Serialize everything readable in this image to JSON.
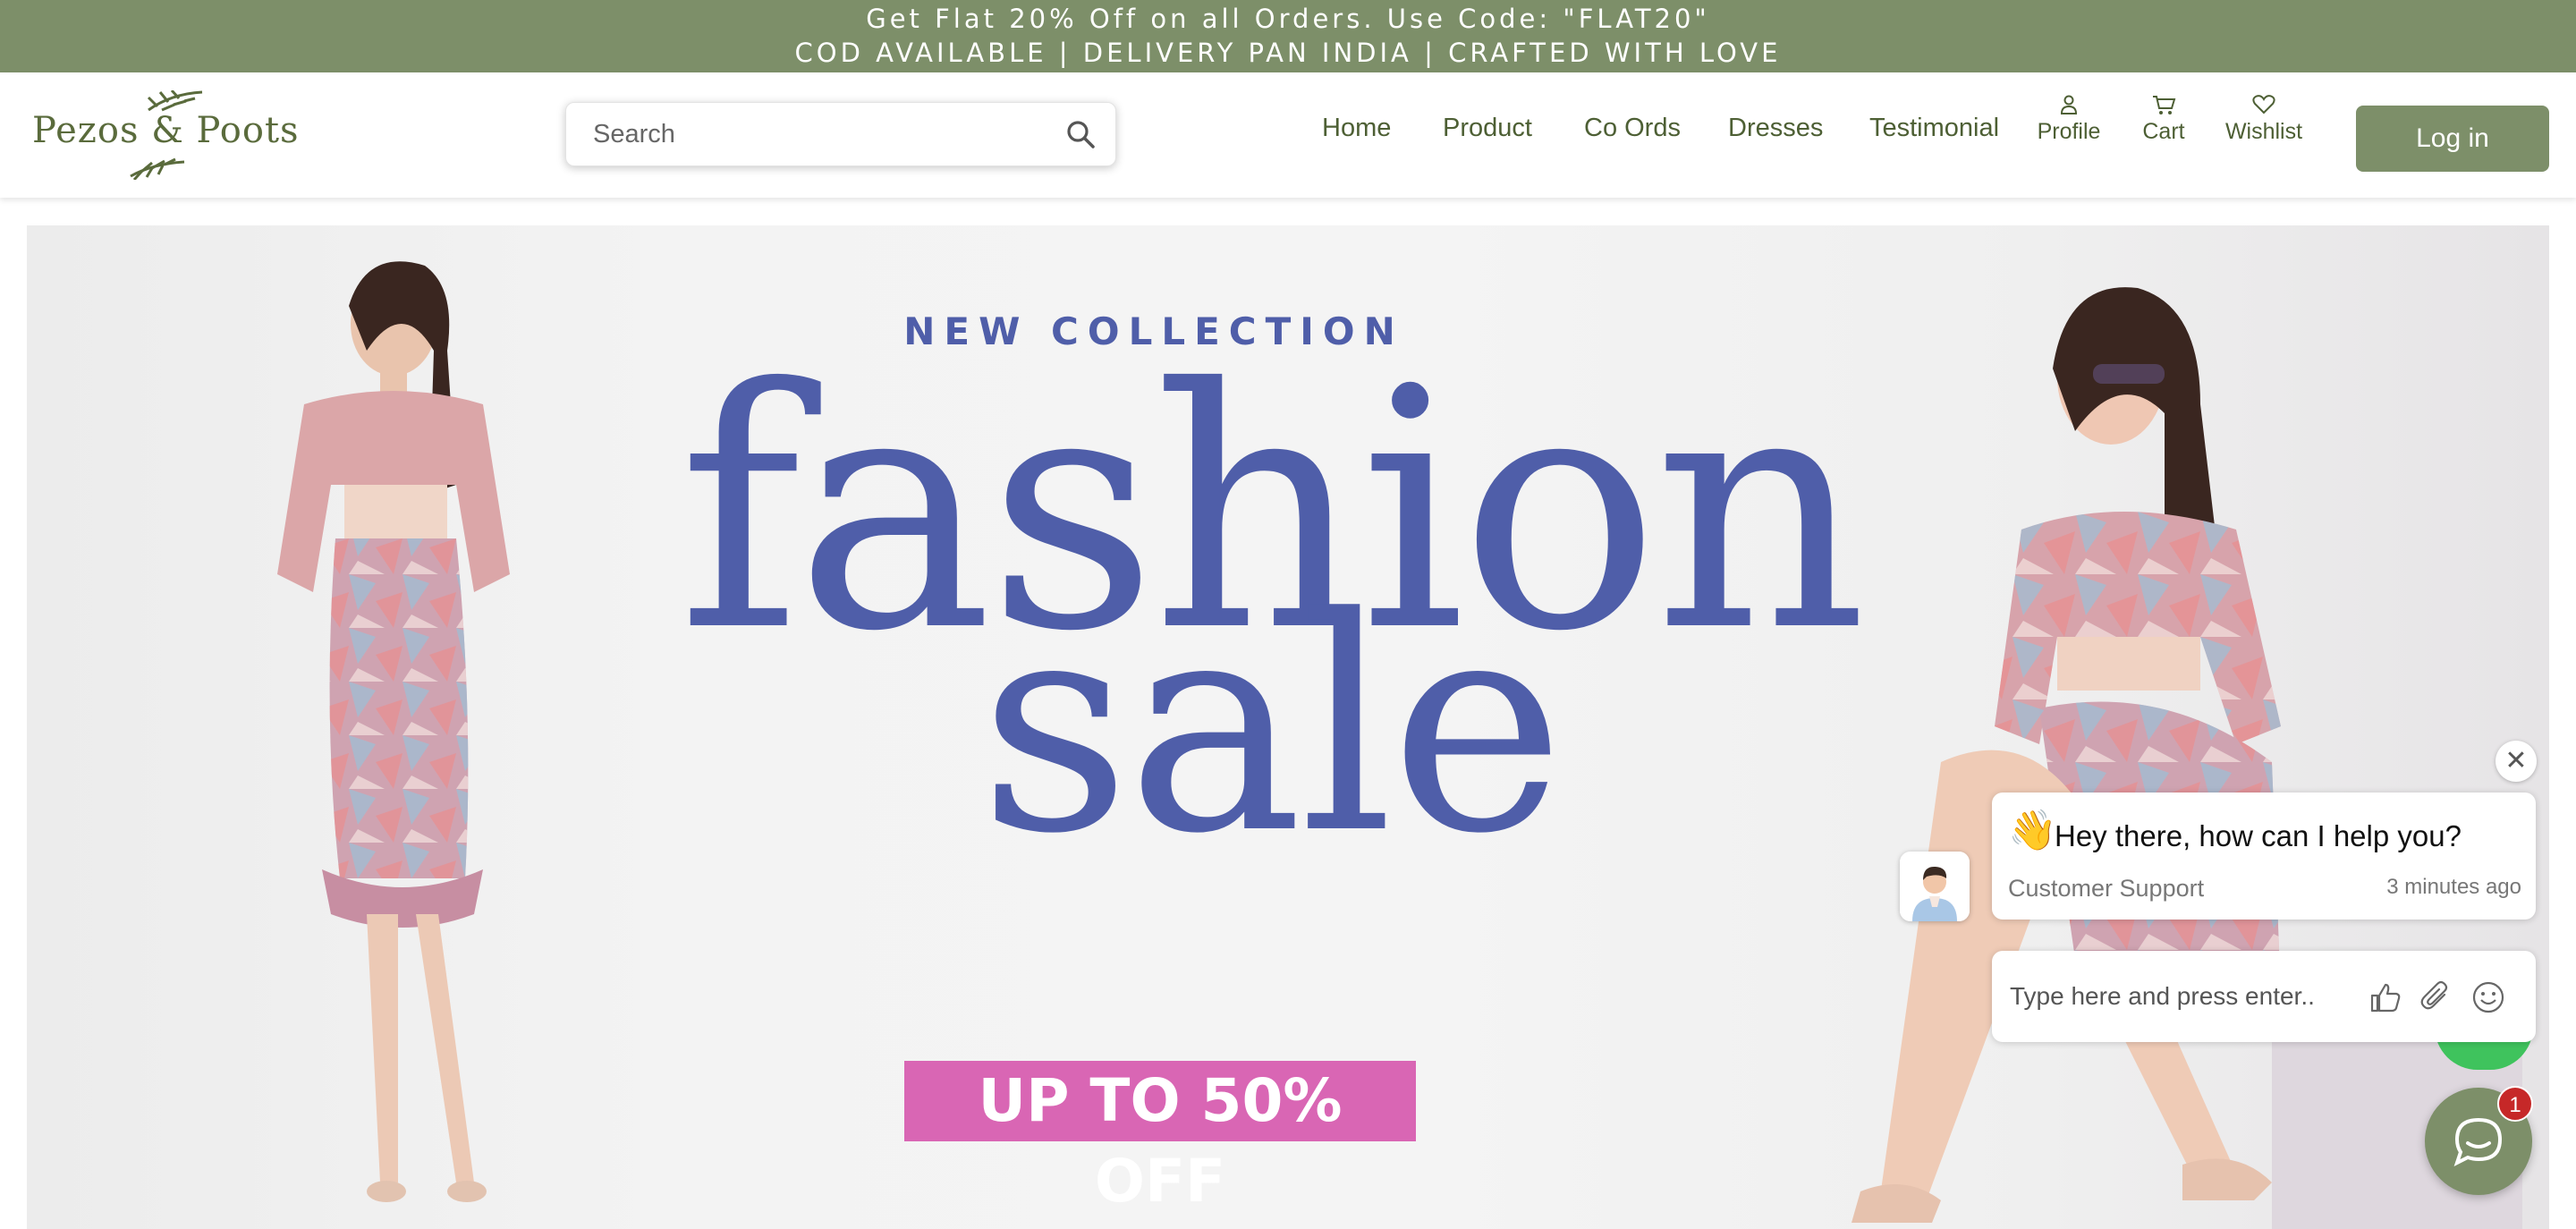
{
  "announcement": {
    "line1": "Get Flat 20% Off on all Orders. Use Code: \"FLAT20\"",
    "line2": "COD AVAILABLE | DELIVERY PAN INDIA | CRAFTED WITH LOVE"
  },
  "brand": {
    "name": "Pezos & Poots",
    "logo_icon": "leaf-icon"
  },
  "search": {
    "placeholder": "Search",
    "value": "",
    "icon": "search-icon"
  },
  "nav": {
    "links": [
      "Home",
      "Product",
      "Co Ords",
      "Dresses",
      "Testimonial"
    ],
    "icons": [
      {
        "label": "Profile",
        "icon": "user-icon"
      },
      {
        "label": "Cart",
        "icon": "cart-icon"
      },
      {
        "label": "Wishlist",
        "icon": "heart-icon"
      }
    ],
    "login_label": "Log in"
  },
  "hero": {
    "eyebrow": "NEW COLLECTION",
    "headline_1": "fashion",
    "headline_2": "sale",
    "promo": "UP TO 50% OFF"
  },
  "chat": {
    "greeting": "Hey there, how can I help you?",
    "agent": "Customer Support",
    "time": "3 minutes ago",
    "input_placeholder": "Type here and press enter..",
    "unread_count": "1"
  },
  "colors": {
    "brand_green": "#7d8f69",
    "nav_text": "#4d5f34",
    "headline_blue": "#4f5ea9",
    "promo_pink": "#d966b4"
  }
}
